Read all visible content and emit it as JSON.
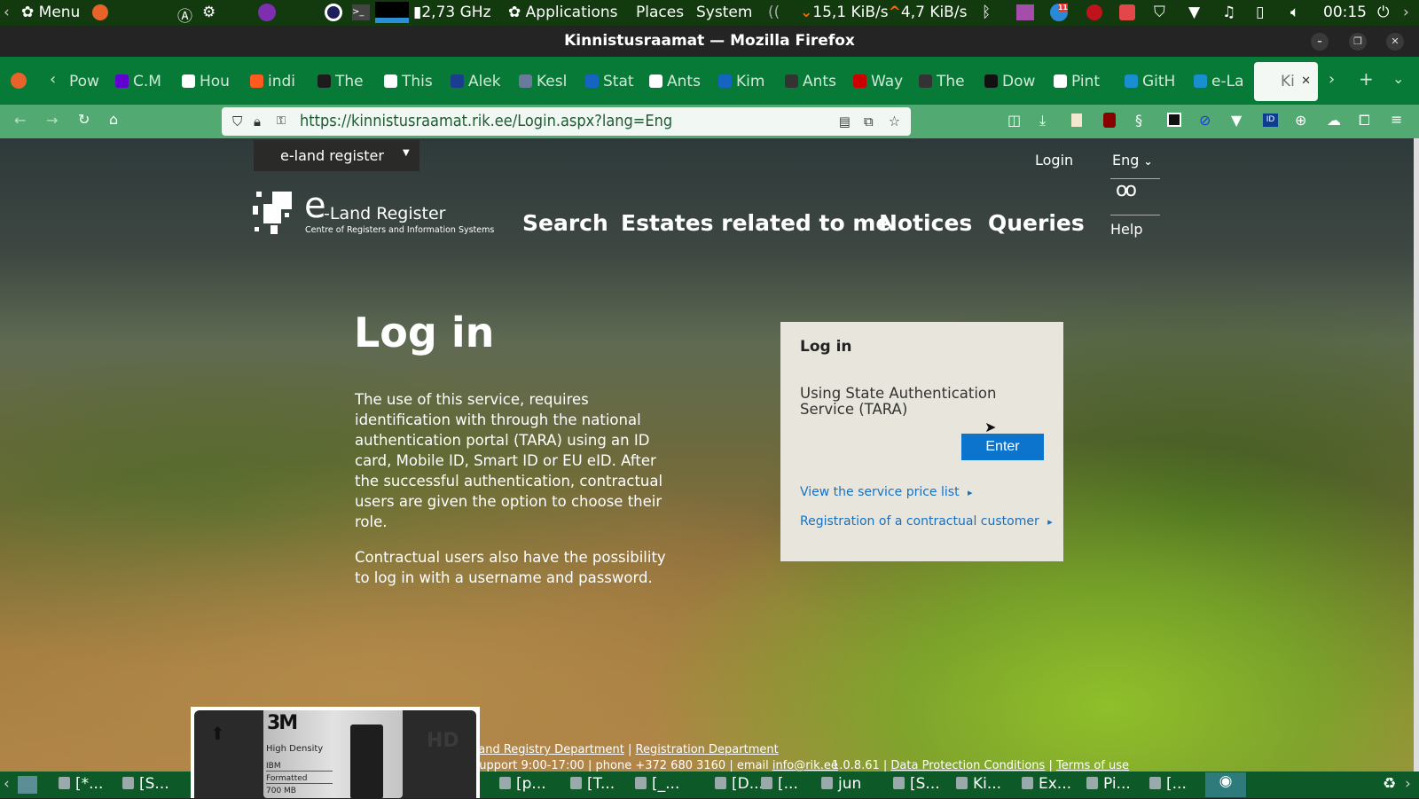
{
  "system_panel": {
    "menu": "Menu",
    "cpu": "2,73 GHz",
    "applications": "Applications",
    "places": "Places",
    "system": "System",
    "net_down": "15,1 KiB/s",
    "net_up": "4,7 KiB/s",
    "clock": "00:15",
    "badge": "11"
  },
  "window": {
    "title": "Kinnistusraamat — Mozilla Firefox"
  },
  "tabs": [
    "Pow",
    "C.M",
    "Hou",
    "indi",
    "The",
    "This",
    "Alek",
    "Kesl",
    "Stat",
    "Ants",
    "Kim",
    "Ants",
    "Way",
    "The",
    "Dow",
    "Pint",
    "GitH",
    "e-La",
    "Ki"
  ],
  "tab_colors": [
    "#0a66c2",
    "#6001d2",
    "#ffffff",
    "#ff5a1f",
    "#1c1c1c",
    "#ffffff",
    "#1b3d8f",
    "#6a7a9a",
    "#1565c0",
    "#ffffff",
    "#1565c0",
    "#333333",
    "#cc0000",
    "#333333",
    "#111111",
    "#ffffff",
    "#1a8fd0",
    "#1a8fd0"
  ],
  "url": "https://kinnistusraamat.rik.ee/Login.aspx?lang=Eng",
  "site": {
    "register_select": "e-land register",
    "login_link": "Login",
    "lang": "Eng",
    "help": "Help",
    "logo_title": "e-Land Register",
    "logo_letter": "e",
    "logo_rest": "-Land Register",
    "logo_sub": "Centre of Registers and Information Systems",
    "nav": [
      "Search",
      "Estates related to me",
      "Notices",
      "Queries"
    ],
    "heading": "Log in",
    "paragraphs": [
      "The use of this service, requires identification with through the national authentication portal (TARA) using an ID card, Mobile ID, Smart ID or EU eID. After the successful authentication, contractual users are given the option to choose their role.",
      "Contractual users also have the possibility to log in with a username and password."
    ],
    "panel": {
      "title": "Log in",
      "text": "Using State Authentication Service (TARA)",
      "enter": "Enter",
      "links": [
        "View the service price list",
        "Registration of a contractual customer"
      ]
    },
    "footer": {
      "line1": [
        "Land Registry Department",
        "Registration Department"
      ],
      "support": "Support 9:00-17:00 | phone +372 680 3160 | email ",
      "email": "info@rik.ee",
      "version": "1.0.8.61",
      "dpc": "Data Protection Conditions",
      "terms": "Terms of use"
    }
  },
  "floppy": {
    "brand": "3M",
    "density": "High Density",
    "l1": "IBM",
    "l2": "Formatted",
    "l3": "700 MB",
    "hd": "HD"
  },
  "taskbar": [
    "[*...",
    "[S...",
    "[p...",
    "[T...",
    "[_...",
    "[D...",
    "[...",
    "jun",
    "[S...",
    "Ki...",
    "Ex...",
    "Pi...",
    "[..."
  ]
}
